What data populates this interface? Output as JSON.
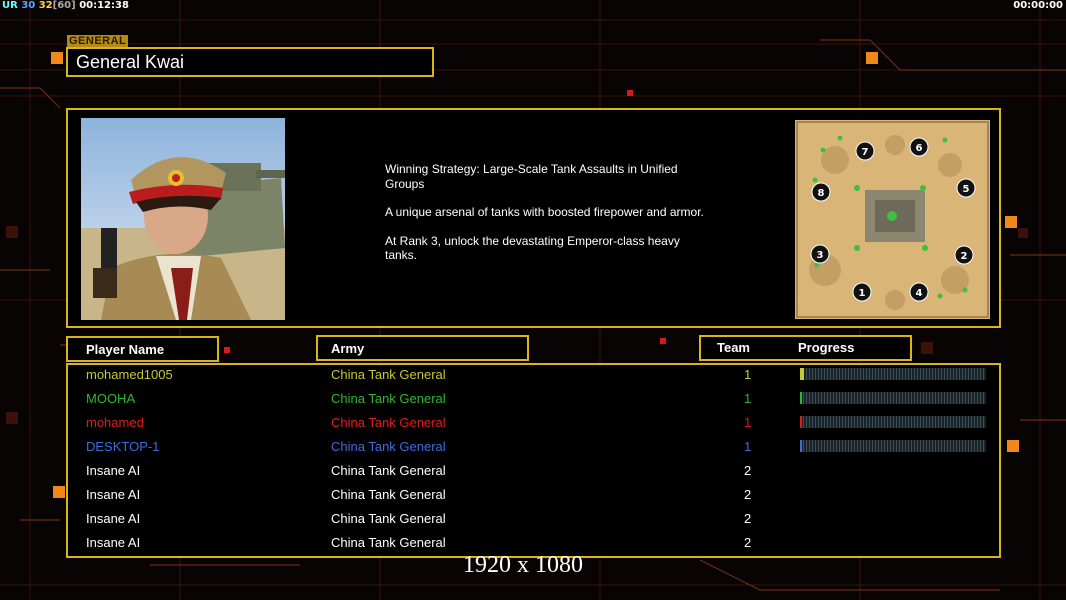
{
  "hud": {
    "ur_label": "UR",
    "n1": "30",
    "n2": "32",
    "n3": "[60]",
    "elapsed": "00:12:38",
    "timer": "00:00:00"
  },
  "general": {
    "tag": "GENERAL",
    "name": "General Kwai"
  },
  "description": {
    "p1": "Winning Strategy: Large-Scale Tank Assaults in Unified Groups",
    "p2": "A unique arsenal of tanks with boosted firepower and armor.",
    "p3": "At Rank 3, unlock the devastating Emperor-class heavy tanks."
  },
  "headers": {
    "player": "Player Name",
    "army": "Army",
    "team": "Team",
    "progress": "Progress"
  },
  "players": [
    {
      "name": "mohamed1005",
      "army": "China Tank General",
      "team": "1",
      "color": "#c8c832",
      "progress": 0.02
    },
    {
      "name": "MOOHA",
      "army": "China Tank General",
      "team": "1",
      "color": "#2fb82f",
      "progress": 0.01
    },
    {
      "name": "mohamed",
      "army": "China Tank General",
      "team": "1",
      "color": "#e01b1b",
      "progress": 0.01
    },
    {
      "name": "DESKTOP-1",
      "army": "China Tank General",
      "team": "1",
      "color": "#3f6de0",
      "progress": 0.01
    },
    {
      "name": "Insane AI",
      "army": "China Tank General",
      "team": "2",
      "color": "#ffffff",
      "progress": null
    },
    {
      "name": "Insane AI",
      "army": "China Tank General",
      "team": "2",
      "color": "#ffffff",
      "progress": null
    },
    {
      "name": "Insane AI",
      "army": "China Tank General",
      "team": "2",
      "color": "#ffffff",
      "progress": null
    },
    {
      "name": "Insane AI",
      "army": "China Tank General",
      "team": "2",
      "color": "#ffffff",
      "progress": null
    }
  ],
  "map_slots": [
    "1",
    "2",
    "3",
    "4",
    "5",
    "6",
    "7",
    "8"
  ],
  "resolution_label": "1920 x 1080",
  "colors": {
    "accent": "#d9b515",
    "background": "#080404"
  }
}
